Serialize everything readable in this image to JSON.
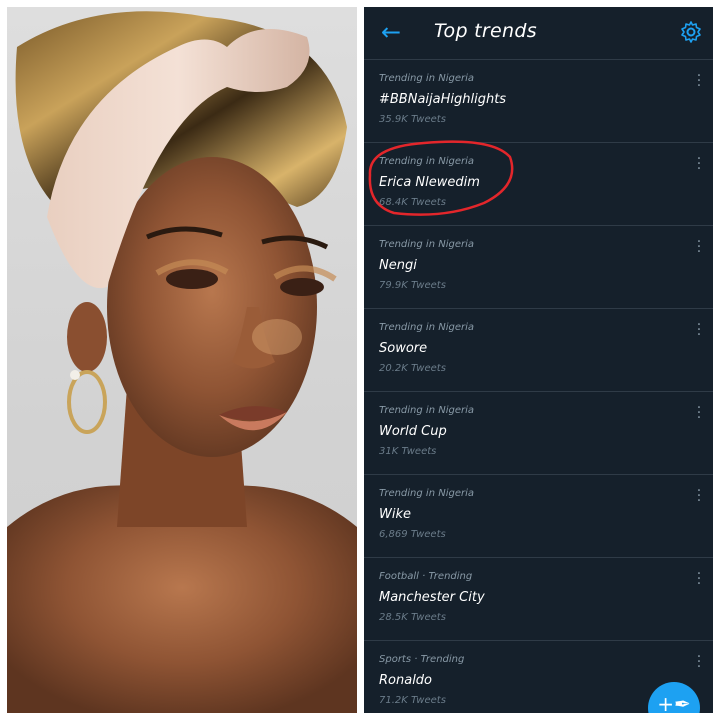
{
  "header": {
    "back_icon": "arrow-left-icon",
    "title": "Top trends",
    "settings_icon": "gear-icon",
    "accent_color": "#1da1f2"
  },
  "trends": [
    {
      "context": "Trending in Nigeria",
      "name": "#BBNaijaHighlights",
      "count": "35.9K Tweets"
    },
    {
      "context": "Trending in Nigeria",
      "name": "Erica Nlewedim",
      "count": "68.4K Tweets"
    },
    {
      "context": "Trending in Nigeria",
      "name": "Nengi",
      "count": "79.9K Tweets"
    },
    {
      "context": "Trending in Nigeria",
      "name": "Sowore",
      "count": "20.2K Tweets"
    },
    {
      "context": "Trending in Nigeria",
      "name": "World Cup",
      "count": "31K Tweets"
    },
    {
      "context": "Trending in Nigeria",
      "name": "Wike",
      "count": "6,869 Tweets"
    },
    {
      "context": "Football · Trending",
      "name": "Manchester City",
      "count": "28.5K Tweets"
    },
    {
      "context": "Sports · Trending",
      "name": "Ronaldo",
      "count": "71.2K Tweets"
    }
  ],
  "annotation": {
    "shape": "hand-drawn circle",
    "color": "#e3262b"
  },
  "compose": {
    "icon": "compose-plus-icon"
  },
  "theme": {
    "background": "#15202b",
    "divider": "#2f3b47",
    "muted_text": "#8899a6"
  }
}
